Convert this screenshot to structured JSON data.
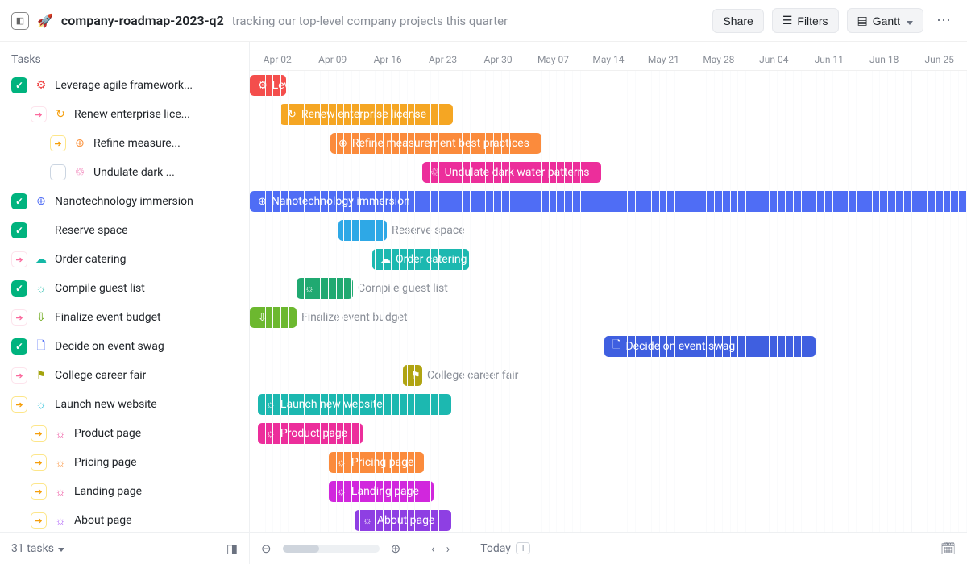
{
  "header": {
    "title": "company-roadmap-2023-q2",
    "subtitle": "tracking our top-level company projects this quarter",
    "share": "Share",
    "filters": "Filters",
    "view": "Gantt"
  },
  "columns": {
    "tasks": "Tasks"
  },
  "timeline": {
    "start": "2023-04-02",
    "col_days": 7,
    "headers": [
      "Apr 02",
      "Apr 09",
      "Apr 16",
      "Apr 23",
      "Apr 30",
      "May 07",
      "May 14",
      "May 21",
      "May 28",
      "Jun 04",
      "Jun 11",
      "Jun 18",
      "Jun 25"
    ]
  },
  "tasks": [
    {
      "label": "Leverage agile framework...",
      "full": "Leverage agile frameworks to provide a rob...",
      "indent": 0,
      "status": "done",
      "icon": "⚙",
      "iconColor": "c-red",
      "bar": {
        "color": "#f44e4c",
        "start": 0,
        "span": 45,
        "extend": ""
      }
    },
    {
      "label": "Renew enterprise lice...",
      "full": "Renew enterprise license",
      "indent": 1,
      "status": "progress",
      "icon": "↻",
      "iconColor": "c-amber",
      "bar": {
        "color": "#f5a623",
        "start": 37,
        "span": 215,
        "extend": ""
      }
    },
    {
      "label": "Refine measure...",
      "full": "Refine measurement best practices",
      "indent": 2,
      "status": "yellow",
      "icon": "⊕",
      "iconColor": "c-orange",
      "bar": {
        "color": "#fb8b3c",
        "start": 100,
        "span": 262,
        "extend": ""
      }
    },
    {
      "label": "Undulate dark ...",
      "full": "Undulate dark water patterns",
      "indent": 2,
      "status": "todo",
      "icon": "♲",
      "iconColor": "c-pink",
      "bar": {
        "color": "#ec2e9b",
        "start": 214,
        "span": 222,
        "extend": ""
      }
    },
    {
      "label": "Nanotechnology immersion",
      "full": "Nanotechnology immersion",
      "indent": 0,
      "status": "done",
      "icon": "⊕",
      "iconColor": "c-blue",
      "bar": {
        "color": "#4f6df5",
        "start": 0,
        "span": 900,
        "extend": ""
      }
    },
    {
      "label": "Reserve space",
      "full": "",
      "indent": 0,
      "status": "done",
      "icon": "",
      "iconColor": "c-sky",
      "bar": {
        "color": "#2ea8e6",
        "start": 110,
        "span": 60,
        "extend": "Reserve space"
      }
    },
    {
      "label": "Order catering",
      "full": "Order catering",
      "indent": 0,
      "status": "progress",
      "icon": "☁",
      "iconColor": "c-teal",
      "bar": {
        "color": "#1cb8b0",
        "start": 152,
        "span": 120,
        "extend": ""
      }
    },
    {
      "label": "Compile guest list",
      "full": "",
      "indent": 0,
      "status": "done",
      "icon": "☼",
      "iconColor": "c-teal",
      "bar": {
        "color": "#20a971",
        "start": 58,
        "span": 70,
        "extend": "Compile guest list"
      }
    },
    {
      "label": "Finalize event budget",
      "full": "",
      "indent": 0,
      "status": "progress",
      "icon": "⇩",
      "iconColor": "c-green",
      "bar": {
        "color": "#6cb82f",
        "start": 0,
        "span": 58,
        "extend": "Finalize event budget"
      }
    },
    {
      "label": "Decide on event swag",
      "full": "Decide on event swag",
      "indent": 0,
      "status": "done",
      "icon": "🗋",
      "iconColor": "c-blue",
      "bar": {
        "color": "#3f5fe0",
        "start": 440,
        "span": 262,
        "extend": ""
      }
    },
    {
      "label": "College career fair",
      "full": "",
      "indent": 0,
      "status": "progress",
      "icon": "⚑",
      "iconColor": "c-olive",
      "bar": {
        "color": "#b0a412",
        "start": 190,
        "span": 24,
        "extend": "College career fair"
      }
    },
    {
      "label": "Launch new website",
      "full": "Launch new website",
      "indent": 0,
      "status": "yellow",
      "icon": "☼",
      "iconColor": "c-cyan",
      "bar": {
        "color": "#1cb8b0",
        "start": 10,
        "span": 240,
        "extend": ""
      }
    },
    {
      "label": "Product page",
      "full": "Product page",
      "indent": 1,
      "status": "yellow",
      "icon": "☼",
      "iconColor": "c-pink",
      "bar": {
        "color": "#ec2e9b",
        "start": 10,
        "span": 130,
        "extend": ""
      }
    },
    {
      "label": "Pricing page",
      "full": "Pricing page",
      "indent": 1,
      "status": "yellow",
      "icon": "☼",
      "iconColor": "c-orange",
      "bar": {
        "color": "#fb8b3c",
        "start": 98,
        "span": 118,
        "extend": ""
      }
    },
    {
      "label": "Landing page",
      "full": "Landing page",
      "indent": 1,
      "status": "yellow",
      "icon": "☼",
      "iconColor": "c-pink",
      "bar": {
        "color": "#d127dd",
        "start": 98,
        "span": 130,
        "extend": ""
      }
    },
    {
      "label": "About page",
      "full": "About page",
      "indent": 1,
      "status": "yellow",
      "icon": "☼",
      "iconColor": "c-purple",
      "bar": {
        "color": "#8e3fe3",
        "start": 130,
        "span": 120,
        "extend": ""
      }
    }
  ],
  "footer": {
    "count_label": "31 tasks",
    "today": "Today",
    "today_kbd": "T"
  }
}
